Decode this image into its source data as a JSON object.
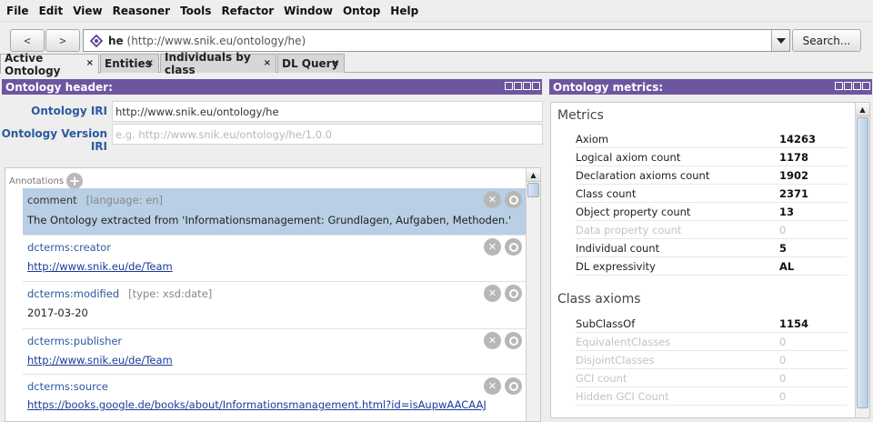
{
  "menu": [
    "File",
    "Edit",
    "View",
    "Reasoner",
    "Tools",
    "Refactor",
    "Window",
    "Ontop",
    "Help"
  ],
  "toolbar": {
    "back_label": "<",
    "forward_label": ">",
    "address_name": "he",
    "address_iri": "(http://www.snik.eu/ontology/he)",
    "search_label": "Search..."
  },
  "tabs": [
    {
      "label": "Active Ontology",
      "close": "×"
    },
    {
      "label": "Entities",
      "close": "×"
    },
    {
      "label": "Individuals by class",
      "close": "×"
    },
    {
      "label": "DL Query",
      "close": "×"
    }
  ],
  "left_panel": {
    "title": "Ontology header:",
    "iri_label": "Ontology IRI",
    "iri_value": "http://www.snik.eu/ontology/he",
    "version_label": "Ontology Version IRI",
    "version_placeholder": "e.g. http://www.snik.eu/ontology/he/1.0.0",
    "annotations_label": "Annotations",
    "annotations": [
      {
        "prop": "comment",
        "meta": "[language: en]",
        "value": "The Ontology extracted from 'Informationsmanagement: Grundlagen, Aufgaben, Methoden.'"
      },
      {
        "prop": "dcterms:creator",
        "meta": "",
        "value": "http://www.snik.eu/de/Team"
      },
      {
        "prop": "dcterms:modified",
        "meta": "[type: xsd:date]",
        "value": "2017-03-20"
      },
      {
        "prop": "dcterms:publisher",
        "meta": "",
        "value": "http://www.snik.eu/de/Team"
      },
      {
        "prop": "dcterms:source",
        "meta": "",
        "value": "https://books.google.de/books/about/Informationsmanagement.html?id=isAupwAACAAJ"
      }
    ]
  },
  "right_panel": {
    "title": "Ontology metrics:",
    "metrics_title": "Metrics",
    "metrics": [
      {
        "k": "Axiom",
        "v": "14263",
        "dim": false
      },
      {
        "k": "Logical axiom count",
        "v": "1178",
        "dim": false
      },
      {
        "k": "Declaration axioms count",
        "v": "1902",
        "dim": false
      },
      {
        "k": "Class count",
        "v": "2371",
        "dim": false
      },
      {
        "k": "Object property count",
        "v": "13",
        "dim": false
      },
      {
        "k": "Data property count",
        "v": "0",
        "dim": true
      },
      {
        "k": "Individual count",
        "v": "5",
        "dim": false
      },
      {
        "k": "DL expressivity",
        "v": "AL",
        "dim": false
      }
    ],
    "class_axioms_title": "Class axioms",
    "class_axioms": [
      {
        "k": "SubClassOf",
        "v": "1154",
        "dim": false
      },
      {
        "k": "EquivalentClasses",
        "v": "0",
        "dim": true
      },
      {
        "k": "DisjointClasses",
        "v": "0",
        "dim": true
      },
      {
        "k": "GCI count",
        "v": "0",
        "dim": true
      },
      {
        "k": "Hidden GCI Count",
        "v": "0",
        "dim": true
      }
    ]
  },
  "colors": {
    "header_purple": "#6e55a0",
    "selection_blue": "#b8cfe5",
    "link_blue": "#1a3a9a"
  }
}
